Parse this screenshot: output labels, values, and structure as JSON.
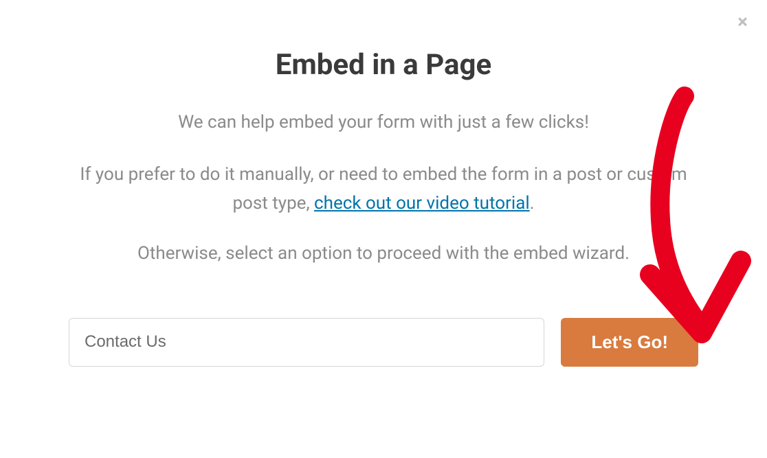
{
  "modal": {
    "title": "Embed in a Page",
    "subtitle": "We can help embed your form with just a few clicks!",
    "paragraph_before_link": "If you prefer to do it manually, or need to embed the form in a post or custom post type, ",
    "link_text": "check out our video tutorial",
    "paragraph_after_link": ".",
    "paragraph_proceed": "Otherwise, select an option to proceed with the embed wizard.",
    "input_value": "Contact Us",
    "go_button_label": "Let's Go!",
    "close_label": "×"
  }
}
